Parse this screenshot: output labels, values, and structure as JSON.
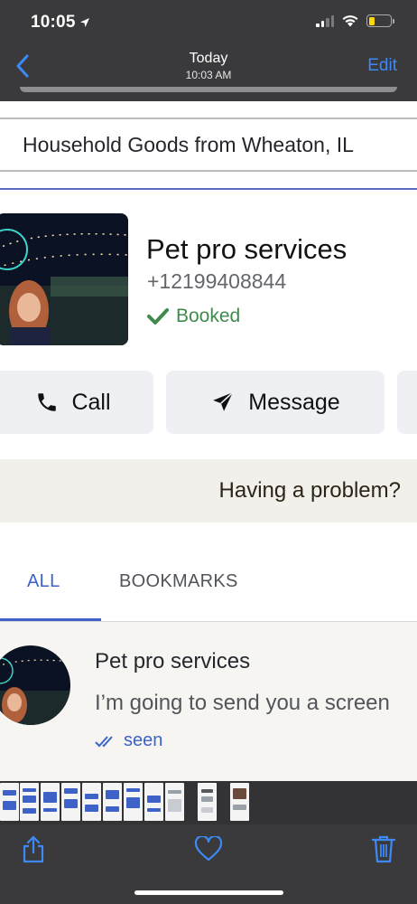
{
  "status_bar": {
    "time": "10:05",
    "battery_level": 0.3
  },
  "nav": {
    "day": "Today",
    "time": "10:03 AM",
    "edit_label": "Edit"
  },
  "route": {
    "title": "Household Goods from Wheaton, IL"
  },
  "provider": {
    "name": "Pet pro services",
    "phone": "+12199408844",
    "status": "Booked"
  },
  "actions": {
    "call_label": "Call",
    "message_label": "Message"
  },
  "problem": {
    "label": "Having a problem?"
  },
  "tabs": [
    {
      "label": "ALL",
      "active": true
    },
    {
      "label": "BOOKMARKS",
      "active": false
    }
  ],
  "message": {
    "sender": "Pet pro services",
    "preview": "I’m going to send you a screen",
    "status": "seen"
  },
  "colors": {
    "accent_blue": "#3d63c8",
    "ios_blue": "#3d8af7",
    "booked_green": "#3f8a4c",
    "chrome_dark": "#3a3a3c"
  },
  "icons": [
    "location-arrow-icon",
    "signal-icon",
    "wifi-icon",
    "battery-icon",
    "back-chevron-icon",
    "checkmark-icon",
    "phone-icon",
    "send-icon",
    "double-check-icon",
    "share-icon",
    "heart-icon",
    "trash-icon"
  ]
}
